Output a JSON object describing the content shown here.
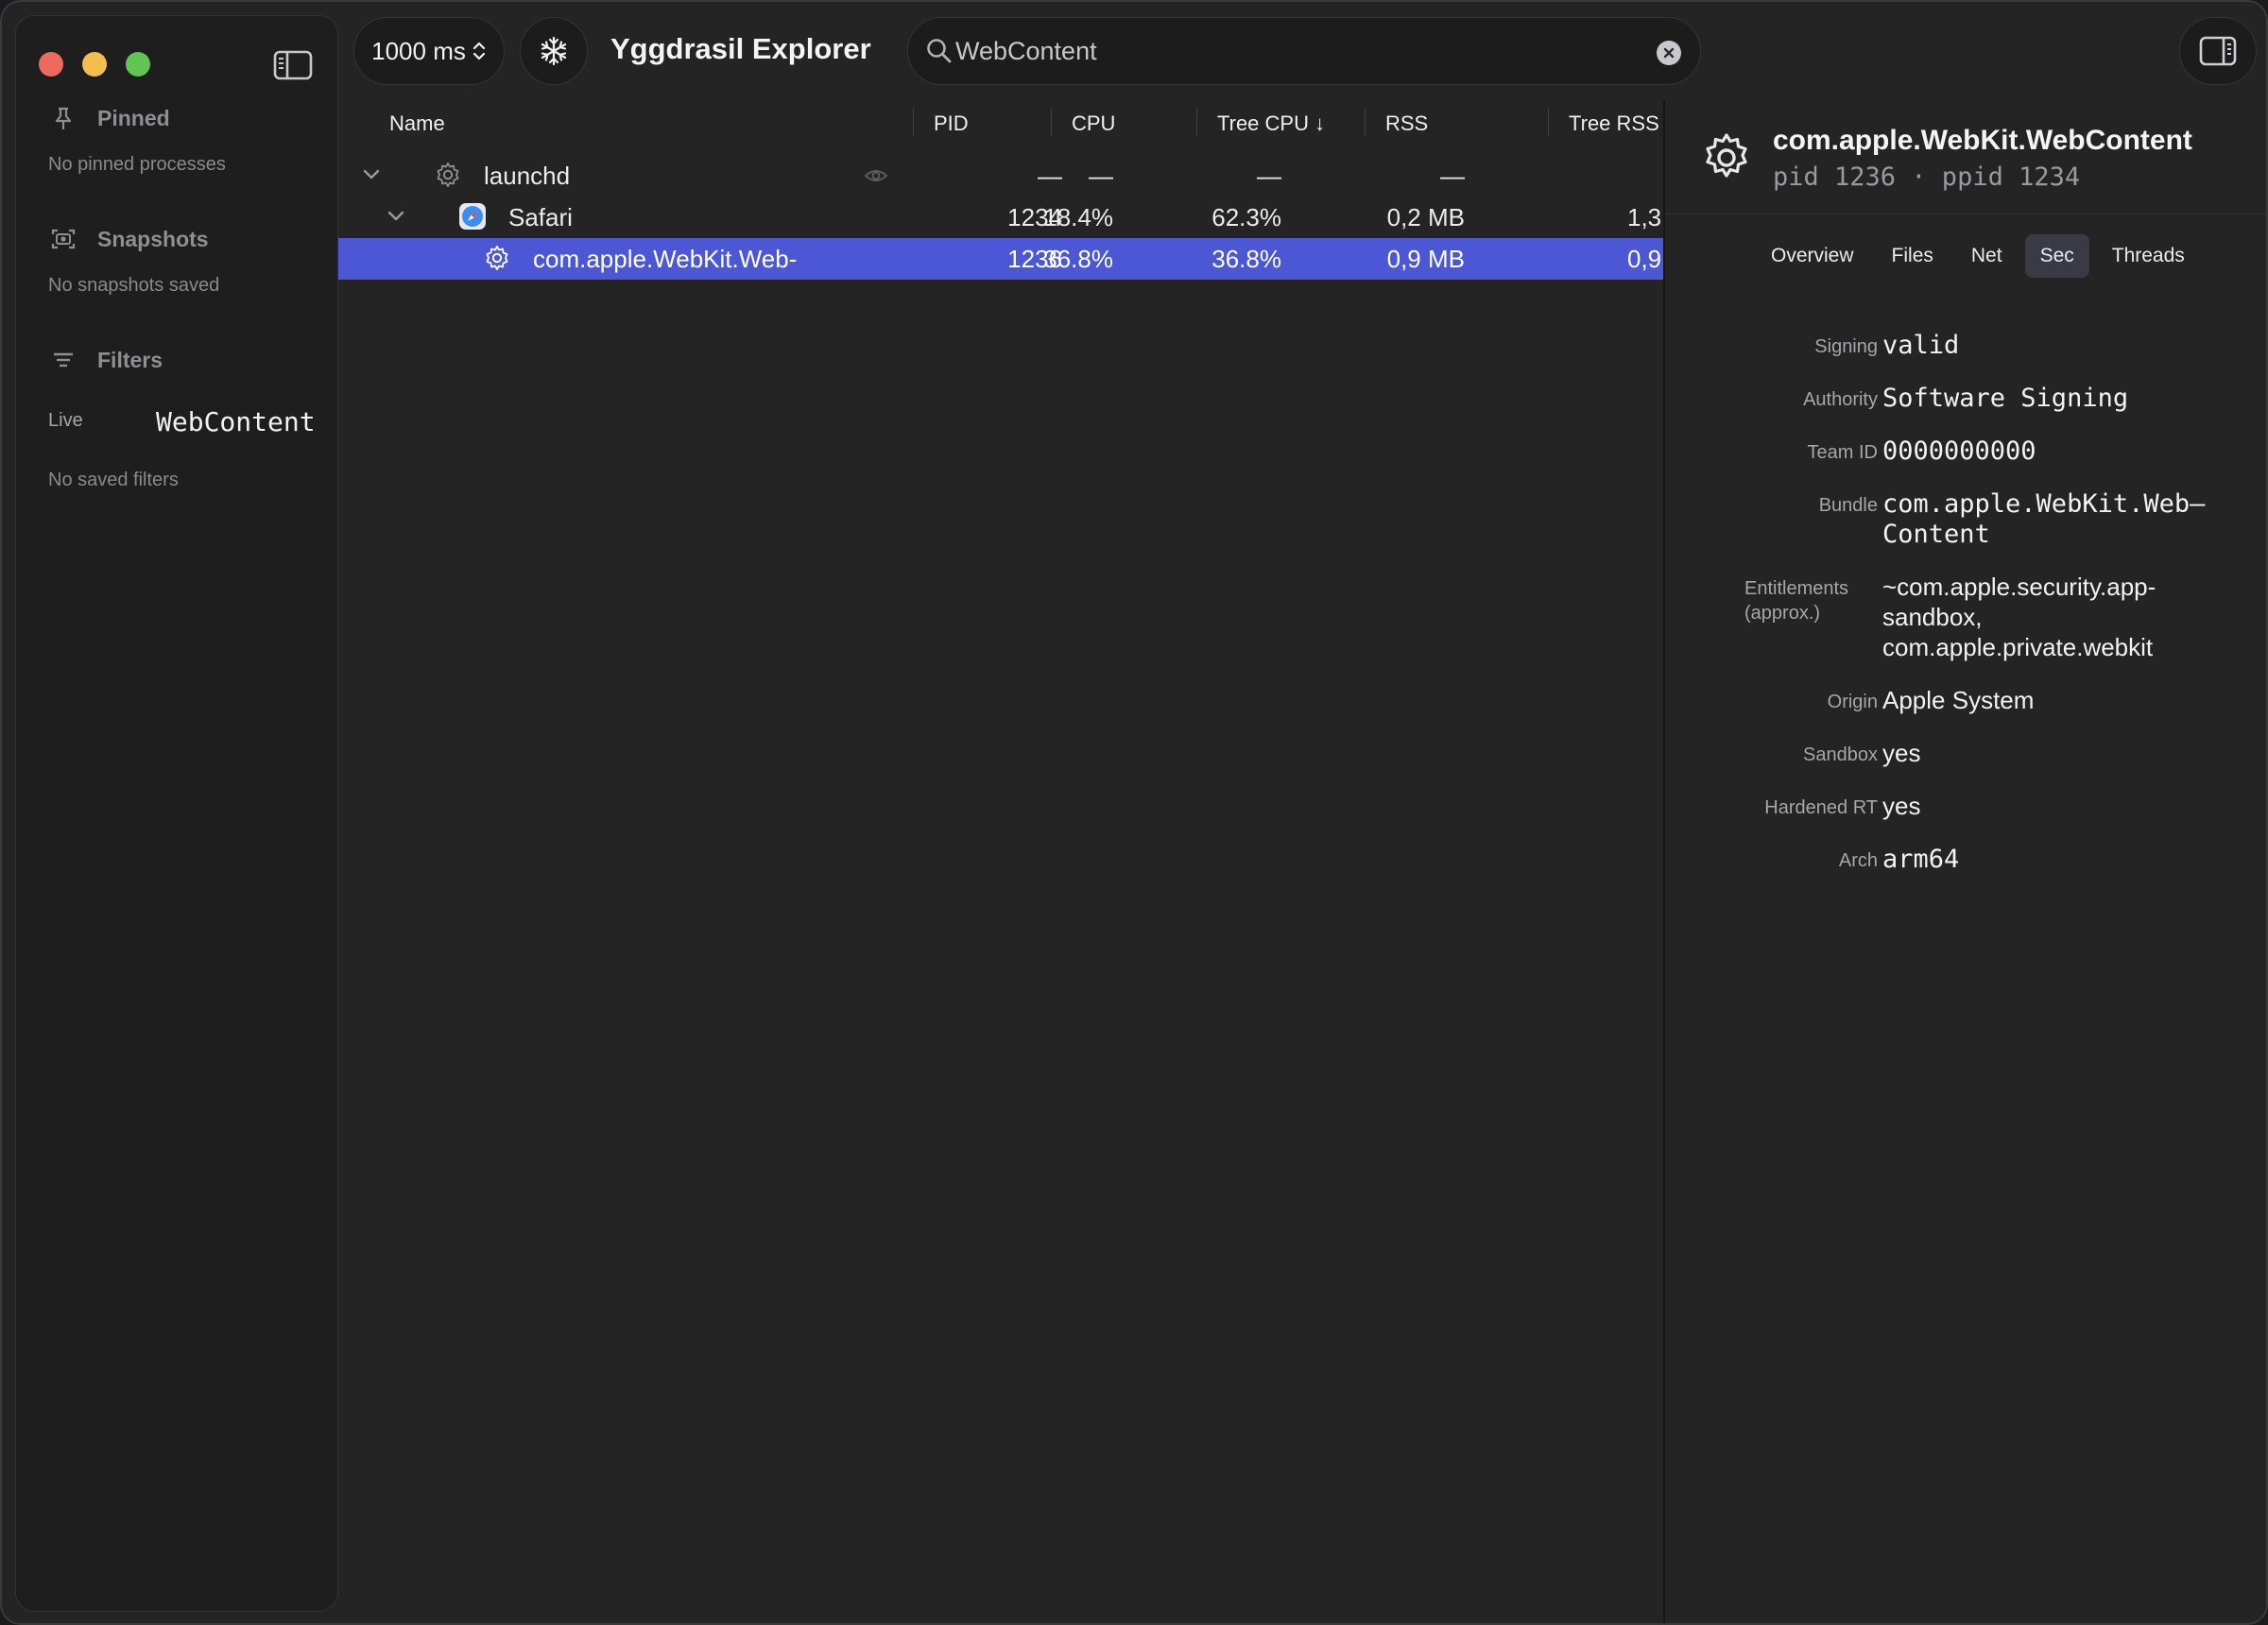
{
  "toolbar": {
    "interval": "1000 ms",
    "title": "Yggdrasil Explorer",
    "search_value": "WebContent"
  },
  "sidebar": {
    "pinned": {
      "title": "Pinned",
      "empty": "No pinned processes"
    },
    "snapshots": {
      "title": "Snapshots",
      "empty": "No snapshots saved"
    },
    "filters": {
      "title": "Filters",
      "live_label": "Live",
      "live_value": "WebContent",
      "empty": "No saved filters"
    }
  },
  "table": {
    "columns": [
      "Name",
      "PID",
      "CPU",
      "Tree CPU ↓",
      "RSS",
      "Tree RSS"
    ],
    "rows": [
      {
        "name": "launchd",
        "pid": "—",
        "cpu": "—",
        "tree_cpu": "—",
        "rss": "—",
        "tree_rss": ""
      },
      {
        "name": "Safari",
        "pid": "1234",
        "cpu": "18.4%",
        "tree_cpu": "62.3%",
        "rss": "0,2 MB",
        "tree_rss": "1,3"
      },
      {
        "name": "com.apple.WebKit.Web-",
        "pid": "1236",
        "cpu": "36.8%",
        "tree_cpu": "36.8%",
        "rss": "0,9 MB",
        "tree_rss": "0,9"
      }
    ]
  },
  "inspector": {
    "title": "com.apple.WebKit.WebContent",
    "subtitle": "pid 1236 · ppid 1234",
    "tabs": [
      "Overview",
      "Files",
      "Net",
      "Sec",
      "Threads"
    ],
    "active_tab": "Sec",
    "fields": {
      "signing": {
        "key": "Signing",
        "value": "valid"
      },
      "authority": {
        "key": "Authority",
        "value": "Software Signing"
      },
      "team_id": {
        "key": "Team ID",
        "value": "0000000000"
      },
      "bundle": {
        "key": "Bundle",
        "value_line1": "com.apple.WebKit.Web–",
        "value_line2": "Content"
      },
      "entitlements": {
        "key_line1": "Entitlements",
        "key_line2": "(approx.)",
        "value_line1": "~com.apple.security.app-",
        "value_line2": "sandbox,",
        "value_line3": "com.apple.private.webkit"
      },
      "origin": {
        "key": "Origin",
        "value": "Apple System"
      },
      "sandbox": {
        "key": "Sandbox",
        "value": "yes"
      },
      "hardened": {
        "key": "Hardened RT",
        "value": "yes"
      },
      "arch": {
        "key": "Arch",
        "value": "arm64"
      }
    }
  },
  "colors": {
    "selection": "#4b57d4",
    "close": "#ed6a5e",
    "minimize": "#f4be4f",
    "maximize": "#61c554"
  }
}
